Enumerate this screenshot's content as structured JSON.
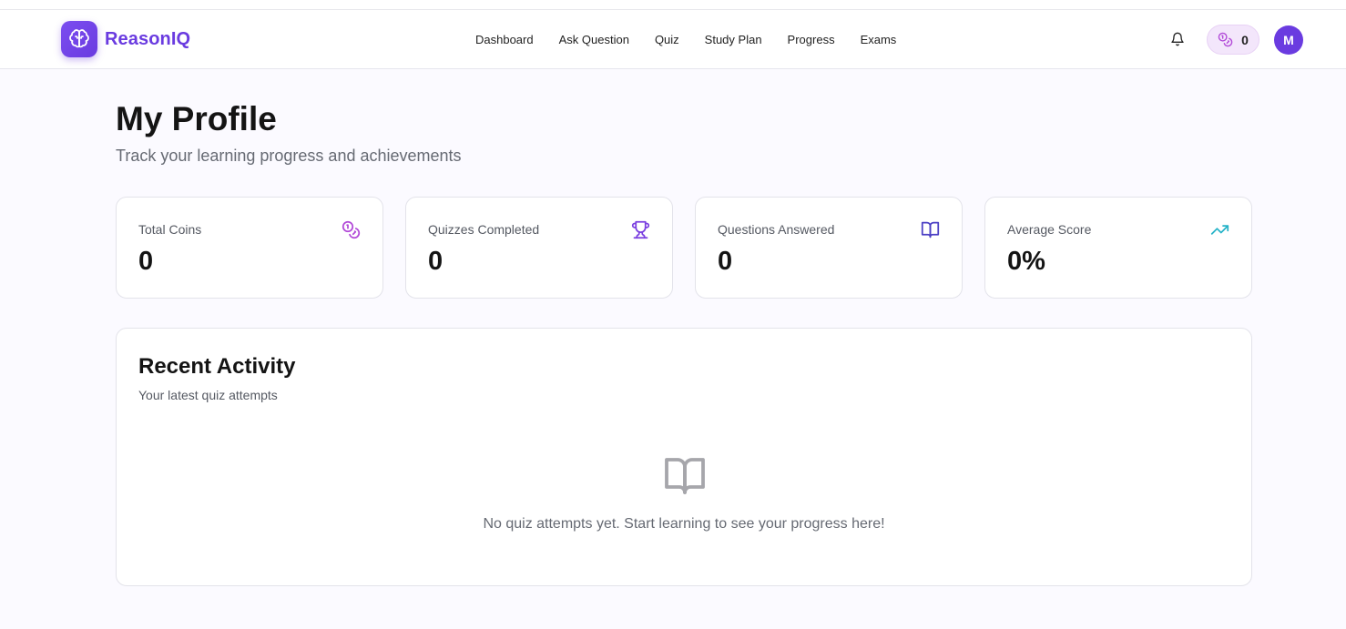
{
  "app": {
    "brand": "ReasonIQ",
    "accent_color": "#6a3be0",
    "logo_icon": "brain-icon"
  },
  "nav": {
    "items": [
      {
        "label": "Dashboard"
      },
      {
        "label": "Ask Question"
      },
      {
        "label": "Quiz"
      },
      {
        "label": "Study Plan"
      },
      {
        "label": "Progress"
      },
      {
        "label": "Exams"
      }
    ]
  },
  "header": {
    "notifications_icon": "bell-icon",
    "coins": {
      "icon": "coins-icon",
      "count": "0"
    },
    "avatar_initial": "M"
  },
  "page": {
    "title": "My Profile",
    "subtitle": "Track your learning progress and achievements"
  },
  "stats": [
    {
      "label": "Total Coins",
      "value": "0",
      "icon": "coins-icon",
      "icon_color": "#b24ad8"
    },
    {
      "label": "Quizzes Completed",
      "value": "0",
      "icon": "trophy-icon",
      "icon_color": "#7a3fe0"
    },
    {
      "label": "Questions Answered",
      "value": "0",
      "icon": "book-open-icon",
      "icon_color": "#4b3fc4"
    },
    {
      "label": "Average Score",
      "value": "0%",
      "icon": "trending-up-icon",
      "icon_color": "#26b3c8"
    }
  ],
  "activity": {
    "title": "Recent Activity",
    "subtitle": "Your latest quiz attempts",
    "empty_icon": "book-open-icon",
    "empty_message": "No quiz attempts yet. Start learning to see your progress here!"
  }
}
